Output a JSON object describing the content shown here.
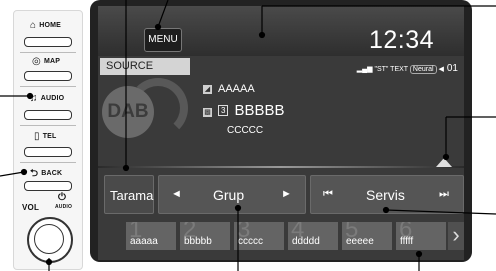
{
  "panel": {
    "home_label": "HOME",
    "home_icon": "house-icon",
    "map_label": "MAP",
    "map_icon": "map-compass-icon",
    "audio_label": "AUDIO",
    "audio_icon": "music-note-icon",
    "tel_label": "TEL",
    "tel_icon": "phone-icon",
    "back_label": "BACK",
    "back_icon": "back-arrow-icon",
    "vol_label": "VOL",
    "vol_audio_label": "AUDIO",
    "power_icon": "power-icon"
  },
  "screen": {
    "menu_label": "MENU",
    "clock": "12:34",
    "source_label": "SOURCE",
    "status_text": "\"ST\" TEXT",
    "neural_badge": "Neural",
    "channel": "01",
    "dab_logo": "DAB",
    "line1": "AAAAA",
    "line2_box": "3",
    "line2": "BBBBB",
    "line3": "CCCCC"
  },
  "controls": {
    "tarama": "Tarama",
    "grup": "Grup",
    "servis": "Servis",
    "prev_arrow": "◄",
    "next_arrow": "►",
    "skip_back": "⏮",
    "skip_fwd": "⏭"
  },
  "presets": [
    {
      "num": "1",
      "label": "aaaaa"
    },
    {
      "num": "2",
      "label": "bbbbb"
    },
    {
      "num": "3",
      "label": "ccccc"
    },
    {
      "num": "4",
      "label": "ddddd"
    },
    {
      "num": "5",
      "label": "eeeee"
    },
    {
      "num": "6",
      "label": "fffff"
    }
  ],
  "preset_more": "›"
}
